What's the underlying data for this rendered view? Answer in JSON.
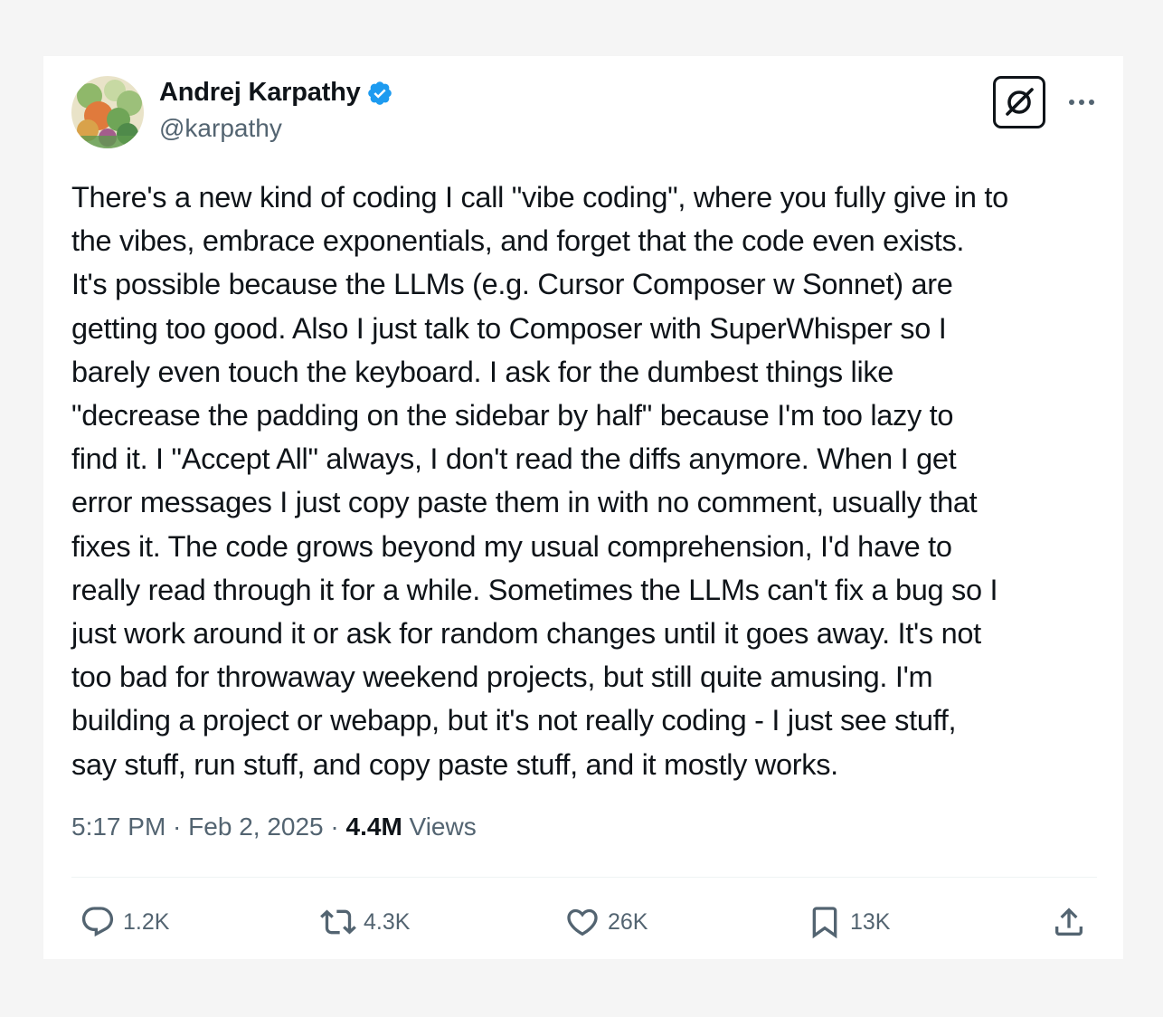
{
  "author": {
    "name": "Andrej Karpathy",
    "handle": "@karpathy",
    "verified_color": "#1d9bf0"
  },
  "tweet": {
    "lines": [
      "There's a new kind of coding I call \"vibe coding\", where you fully give in to",
      "the vibes, embrace exponentials, and forget that the code even exists.",
      "It's possible because the LLMs (e.g. Cursor Composer w Sonnet) are",
      "getting too good. Also I just talk to Composer with SuperWhisper so I",
      "barely even touch the keyboard. I ask for the dumbest things like",
      "\"decrease the padding on the sidebar by half\" because I'm too lazy to",
      "find it. I \"Accept All\" always, I don't read the diffs anymore. When I get",
      "error messages I just copy paste them in with no comment, usually that",
      "fixes it. The code grows beyond my usual comprehension, I'd have to",
      "really read through it for a while. Sometimes the LLMs can't fix a bug so I",
      "just work around it or ask for random changes until it goes away. It's not",
      "too bad for throwaway weekend projects, but still quite amusing. I'm",
      "building a project or webapp, but it's not really coding - I just see stuff,",
      "say stuff, run stuff, and copy paste stuff, and it mostly works."
    ]
  },
  "meta": {
    "time": "5:17 PM",
    "separator": " · ",
    "date": "Feb 2, 2025",
    "views_count": "4.4M",
    "views_label": " Views"
  },
  "actions": {
    "replies": "1.2K",
    "reposts": "4.3K",
    "likes": "26K",
    "bookmarks": "13K"
  },
  "icons": {
    "reply": "speech-bubble-icon",
    "repost": "repost-arrows-icon",
    "like": "heart-icon",
    "bookmark": "bookmark-icon",
    "share": "share-upload-icon",
    "grok": "grok-slash-icon",
    "more": "more-dots-icon",
    "verified": "verified-badge-icon"
  },
  "colors": {
    "text": "#0f1419",
    "secondary": "#536471",
    "divider": "#eff3f4"
  }
}
